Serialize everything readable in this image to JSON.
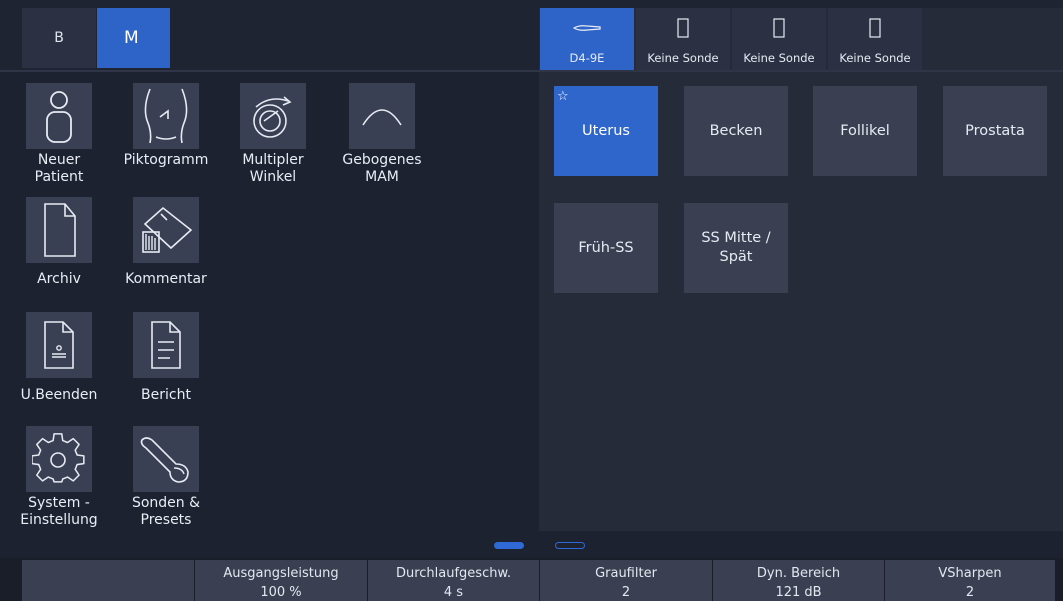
{
  "mode_tabs": [
    {
      "label": "B",
      "active": false
    },
    {
      "label": "M",
      "active": true
    }
  ],
  "probes": [
    {
      "label": "D4-9E",
      "icon": "probe-icon",
      "active": true
    },
    {
      "label": "Keine Sonde",
      "icon": "empty-slot-icon",
      "active": false
    },
    {
      "label": "Keine Sonde",
      "icon": "empty-slot-icon",
      "active": false
    },
    {
      "label": "Keine Sonde",
      "icon": "empty-slot-icon",
      "active": false
    }
  ],
  "tools": [
    {
      "label": "Neuer\nPatient",
      "icon": "new-patient-icon"
    },
    {
      "label": "Piktogramm",
      "icon": "pictogram-icon"
    },
    {
      "label": "Multipler\nWinkel",
      "icon": "multi-angle-icon"
    },
    {
      "label": "Gebogenes\nMAM",
      "icon": "curved-mam-icon"
    },
    {
      "label": "Archiv",
      "icon": "archive-icon"
    },
    {
      "label": "Kommentar",
      "icon": "comment-icon"
    },
    {
      "label": "U.Beenden",
      "icon": "end-exam-icon"
    },
    {
      "label": "Bericht",
      "icon": "report-icon"
    },
    {
      "label": "System -\nEinstellung",
      "icon": "gear-icon"
    },
    {
      "label": "Sonden &\nPresets",
      "icon": "probe-presets-icon"
    }
  ],
  "presets": [
    {
      "label": "Uterus",
      "active": true,
      "favorite": true
    },
    {
      "label": "Becken",
      "active": false
    },
    {
      "label": "Follikel",
      "active": false
    },
    {
      "label": "Prostata",
      "active": false
    },
    {
      "label": "Früh-SS",
      "active": false
    },
    {
      "label": "SS Mitte /\nSpät",
      "active": false
    }
  ],
  "star_glyph": "☆",
  "bottom_params": [
    {
      "label": "",
      "value": ""
    },
    {
      "label": "Ausgangsleistung",
      "value": "100 %"
    },
    {
      "label": "Durchlaufgeschw.",
      "value": "4 s"
    },
    {
      "label": "Graufilter",
      "value": "2"
    },
    {
      "label": "Dyn. Bereich",
      "value": "121 dB"
    },
    {
      "label": "VSharpen",
      "value": "2"
    }
  ],
  "colors": {
    "accent": "#2e63c8",
    "panel": "#262b3a",
    "tile": "#3a4052"
  }
}
